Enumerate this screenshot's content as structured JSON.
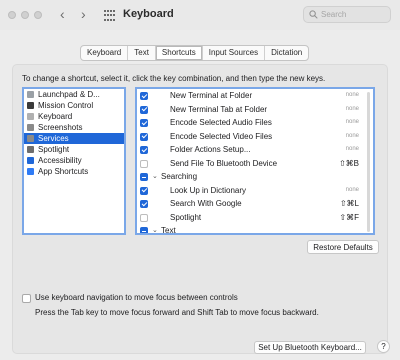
{
  "window": {
    "title": "Keyboard",
    "search_placeholder": "Search",
    "back": "‹",
    "forward": "›"
  },
  "tabs": [
    {
      "label": "Keyboard",
      "active": false
    },
    {
      "label": "Text",
      "active": false
    },
    {
      "label": "Shortcuts",
      "active": true
    },
    {
      "label": "Input Sources",
      "active": false
    },
    {
      "label": "Dictation",
      "active": false
    }
  ],
  "instructions": "To change a shortcut, select it, click the key combination, and then type the new keys.",
  "categories": [
    {
      "label": "Launchpad & D...",
      "icon": "launchpad-icon",
      "color": "#9aa0a6",
      "selected": false
    },
    {
      "label": "Mission Control",
      "icon": "mission-control-icon",
      "color": "#3a3a3a",
      "selected": false
    },
    {
      "label": "Keyboard",
      "icon": "keyboard-icon",
      "color": "#b0b0b0",
      "selected": false
    },
    {
      "label": "Screenshots",
      "icon": "screenshots-icon",
      "color": "#8a8a8a",
      "selected": false
    },
    {
      "label": "Services",
      "icon": "services-icon",
      "color": "#8a8a8a",
      "selected": true
    },
    {
      "label": "Spotlight",
      "icon": "spotlight-icon",
      "color": "#6e6e6e",
      "selected": false
    },
    {
      "label": "Accessibility",
      "icon": "accessibility-icon",
      "color": "#1f67d8",
      "selected": false
    },
    {
      "label": "App Shortcuts",
      "icon": "app-shortcuts-icon",
      "color": "#2f7bf5",
      "selected": false
    }
  ],
  "shortcuts": [
    {
      "type": "item",
      "label": "New Terminal at Folder",
      "key": "none",
      "checked": "on"
    },
    {
      "type": "item",
      "label": "New Terminal Tab at Folder",
      "key": "none",
      "checked": "on"
    },
    {
      "type": "item",
      "label": "Encode Selected Audio Files",
      "key": "none",
      "checked": "on"
    },
    {
      "type": "item",
      "label": "Encode Selected Video Files",
      "key": "none",
      "checked": "on"
    },
    {
      "type": "item",
      "label": "Folder Actions Setup...",
      "key": "none",
      "checked": "on"
    },
    {
      "type": "item",
      "label": "Send File To Bluetooth Device",
      "key": "⇧⌘B",
      "checked": "off"
    },
    {
      "type": "group",
      "label": "Searching",
      "checked": "mixed"
    },
    {
      "type": "item",
      "label": "Look Up in Dictionary",
      "key": "none",
      "checked": "on"
    },
    {
      "type": "item",
      "label": "Search With Google",
      "key": "⇧⌘L",
      "checked": "on"
    },
    {
      "type": "item",
      "label": "Spotlight",
      "key": "⇧⌘F",
      "checked": "off"
    },
    {
      "type": "group",
      "label": "Text",
      "checked": "mixed"
    }
  ],
  "restore_defaults": "Restore Defaults",
  "keyboard_navigation": {
    "label": "Use keyboard navigation to move focus between controls",
    "checked": false,
    "description": "Press the Tab key to move focus forward and Shift Tab to move focus backward."
  },
  "bluetooth_button": "Set Up Bluetooth Keyboard...",
  "help_button": "?",
  "colors": {
    "accent": "#1f67d8",
    "focus_ring": "#7aa7e8"
  }
}
